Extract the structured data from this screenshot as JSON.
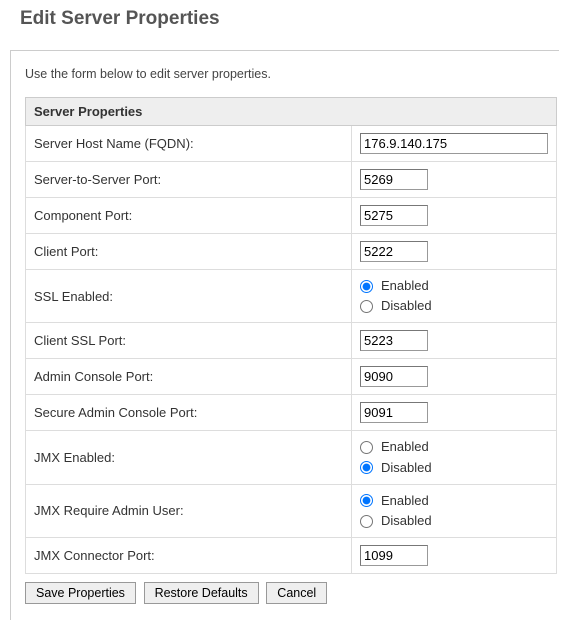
{
  "page": {
    "title": "Edit Server Properties",
    "intro": "Use the form below to edit server properties."
  },
  "section": {
    "header": "Server Properties"
  },
  "labels": {
    "host": "Server Host Name (FQDN):",
    "s2s": "Server-to-Server Port:",
    "component": "Component Port:",
    "client": "Client Port:",
    "ssl_enabled": "SSL Enabled:",
    "client_ssl": "Client SSL Port:",
    "admin": "Admin Console Port:",
    "secure_admin": "Secure Admin Console Port:",
    "jmx_enabled": "JMX Enabled:",
    "jmx_admin": "JMX Require Admin User:",
    "jmx_port": "JMX Connector Port:"
  },
  "values": {
    "host": "176.9.140.175",
    "s2s": "5269",
    "component": "5275",
    "client": "5222",
    "ssl_enabled": "enabled",
    "client_ssl": "5223",
    "admin": "9090",
    "secure_admin": "9091",
    "jmx_enabled": "disabled",
    "jmx_admin": "enabled",
    "jmx_port": "1099"
  },
  "options": {
    "enabled": "Enabled",
    "disabled": "Disabled"
  },
  "buttons": {
    "save": "Save Properties",
    "restore": "Restore Defaults",
    "cancel": "Cancel"
  }
}
